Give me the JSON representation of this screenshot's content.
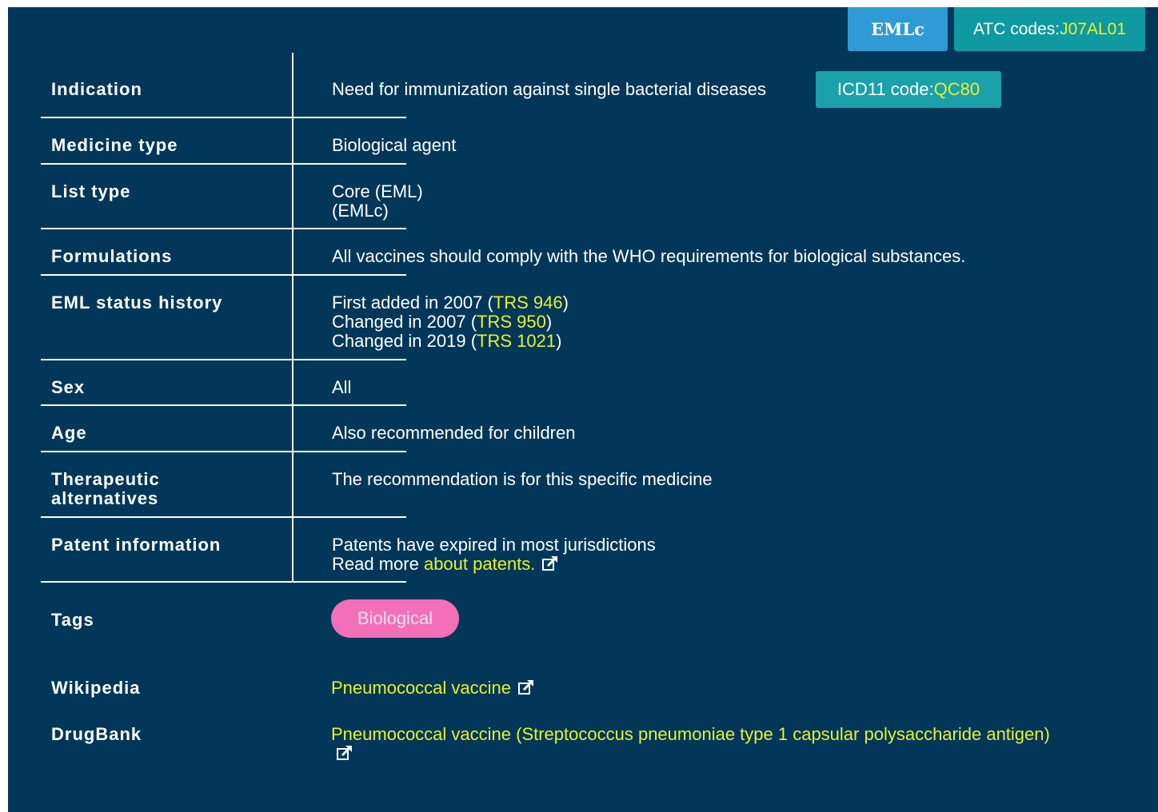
{
  "header": {
    "emlc_label": "EMLc",
    "atc_prefix": "ATC codes: ",
    "atc_code": "J07AL01"
  },
  "rows": {
    "indication": {
      "label": "Indication",
      "value": "Need for immunization against single bacterial diseases",
      "icd_prefix": "ICD11 code: ",
      "icd_code": "QC80"
    },
    "medicine_type": {
      "label": "Medicine type",
      "value": "Biological agent"
    },
    "list_type": {
      "label": "List type",
      "lines": [
        "Core (EML)",
        "(EMLc)"
      ]
    },
    "formulations": {
      "label": "Formulations",
      "value": "All vaccines should comply with the WHO requirements for biological substances."
    },
    "status_history": {
      "label": "EML status history",
      "entries": [
        {
          "text": "First added in 2007 (",
          "ref": "TRS 946",
          "close": ")"
        },
        {
          "text": "Changed in 2007 (",
          "ref": "TRS 950",
          "close": ")"
        },
        {
          "text": "Changed in 2019 (",
          "ref": "TRS 1021",
          "close": ")"
        }
      ]
    },
    "sex": {
      "label": "Sex",
      "value": "All"
    },
    "age": {
      "label": "Age",
      "value": "Also recommended for children"
    },
    "therapeutic": {
      "label_line1": "Therapeutic",
      "label_line2": "alternatives",
      "value": "The recommendation is for this specific medicine"
    },
    "patent": {
      "label": "Patent information",
      "line1": "Patents have expired in most jurisdictions",
      "read_more": "Read more ",
      "link": "about patents."
    },
    "tags": {
      "label": "Tags",
      "tag": "Biological"
    },
    "wikipedia": {
      "label": "Wikipedia",
      "link": "Pneumococcal vaccine"
    },
    "drugbank": {
      "label": "DrugBank",
      "link": "Pneumococcal vaccine (Streptococcus pneumoniae type 1 capsular polysaccharide antigen)"
    }
  },
  "colors": {
    "panel_bg": "#02375a",
    "link": "#e8f02a",
    "emlc_badge": "#2e9ad6",
    "atc_badge": "#0f9aa2",
    "tag_bg": "#f36fb8"
  },
  "icons": {
    "external": "external-link-icon"
  }
}
